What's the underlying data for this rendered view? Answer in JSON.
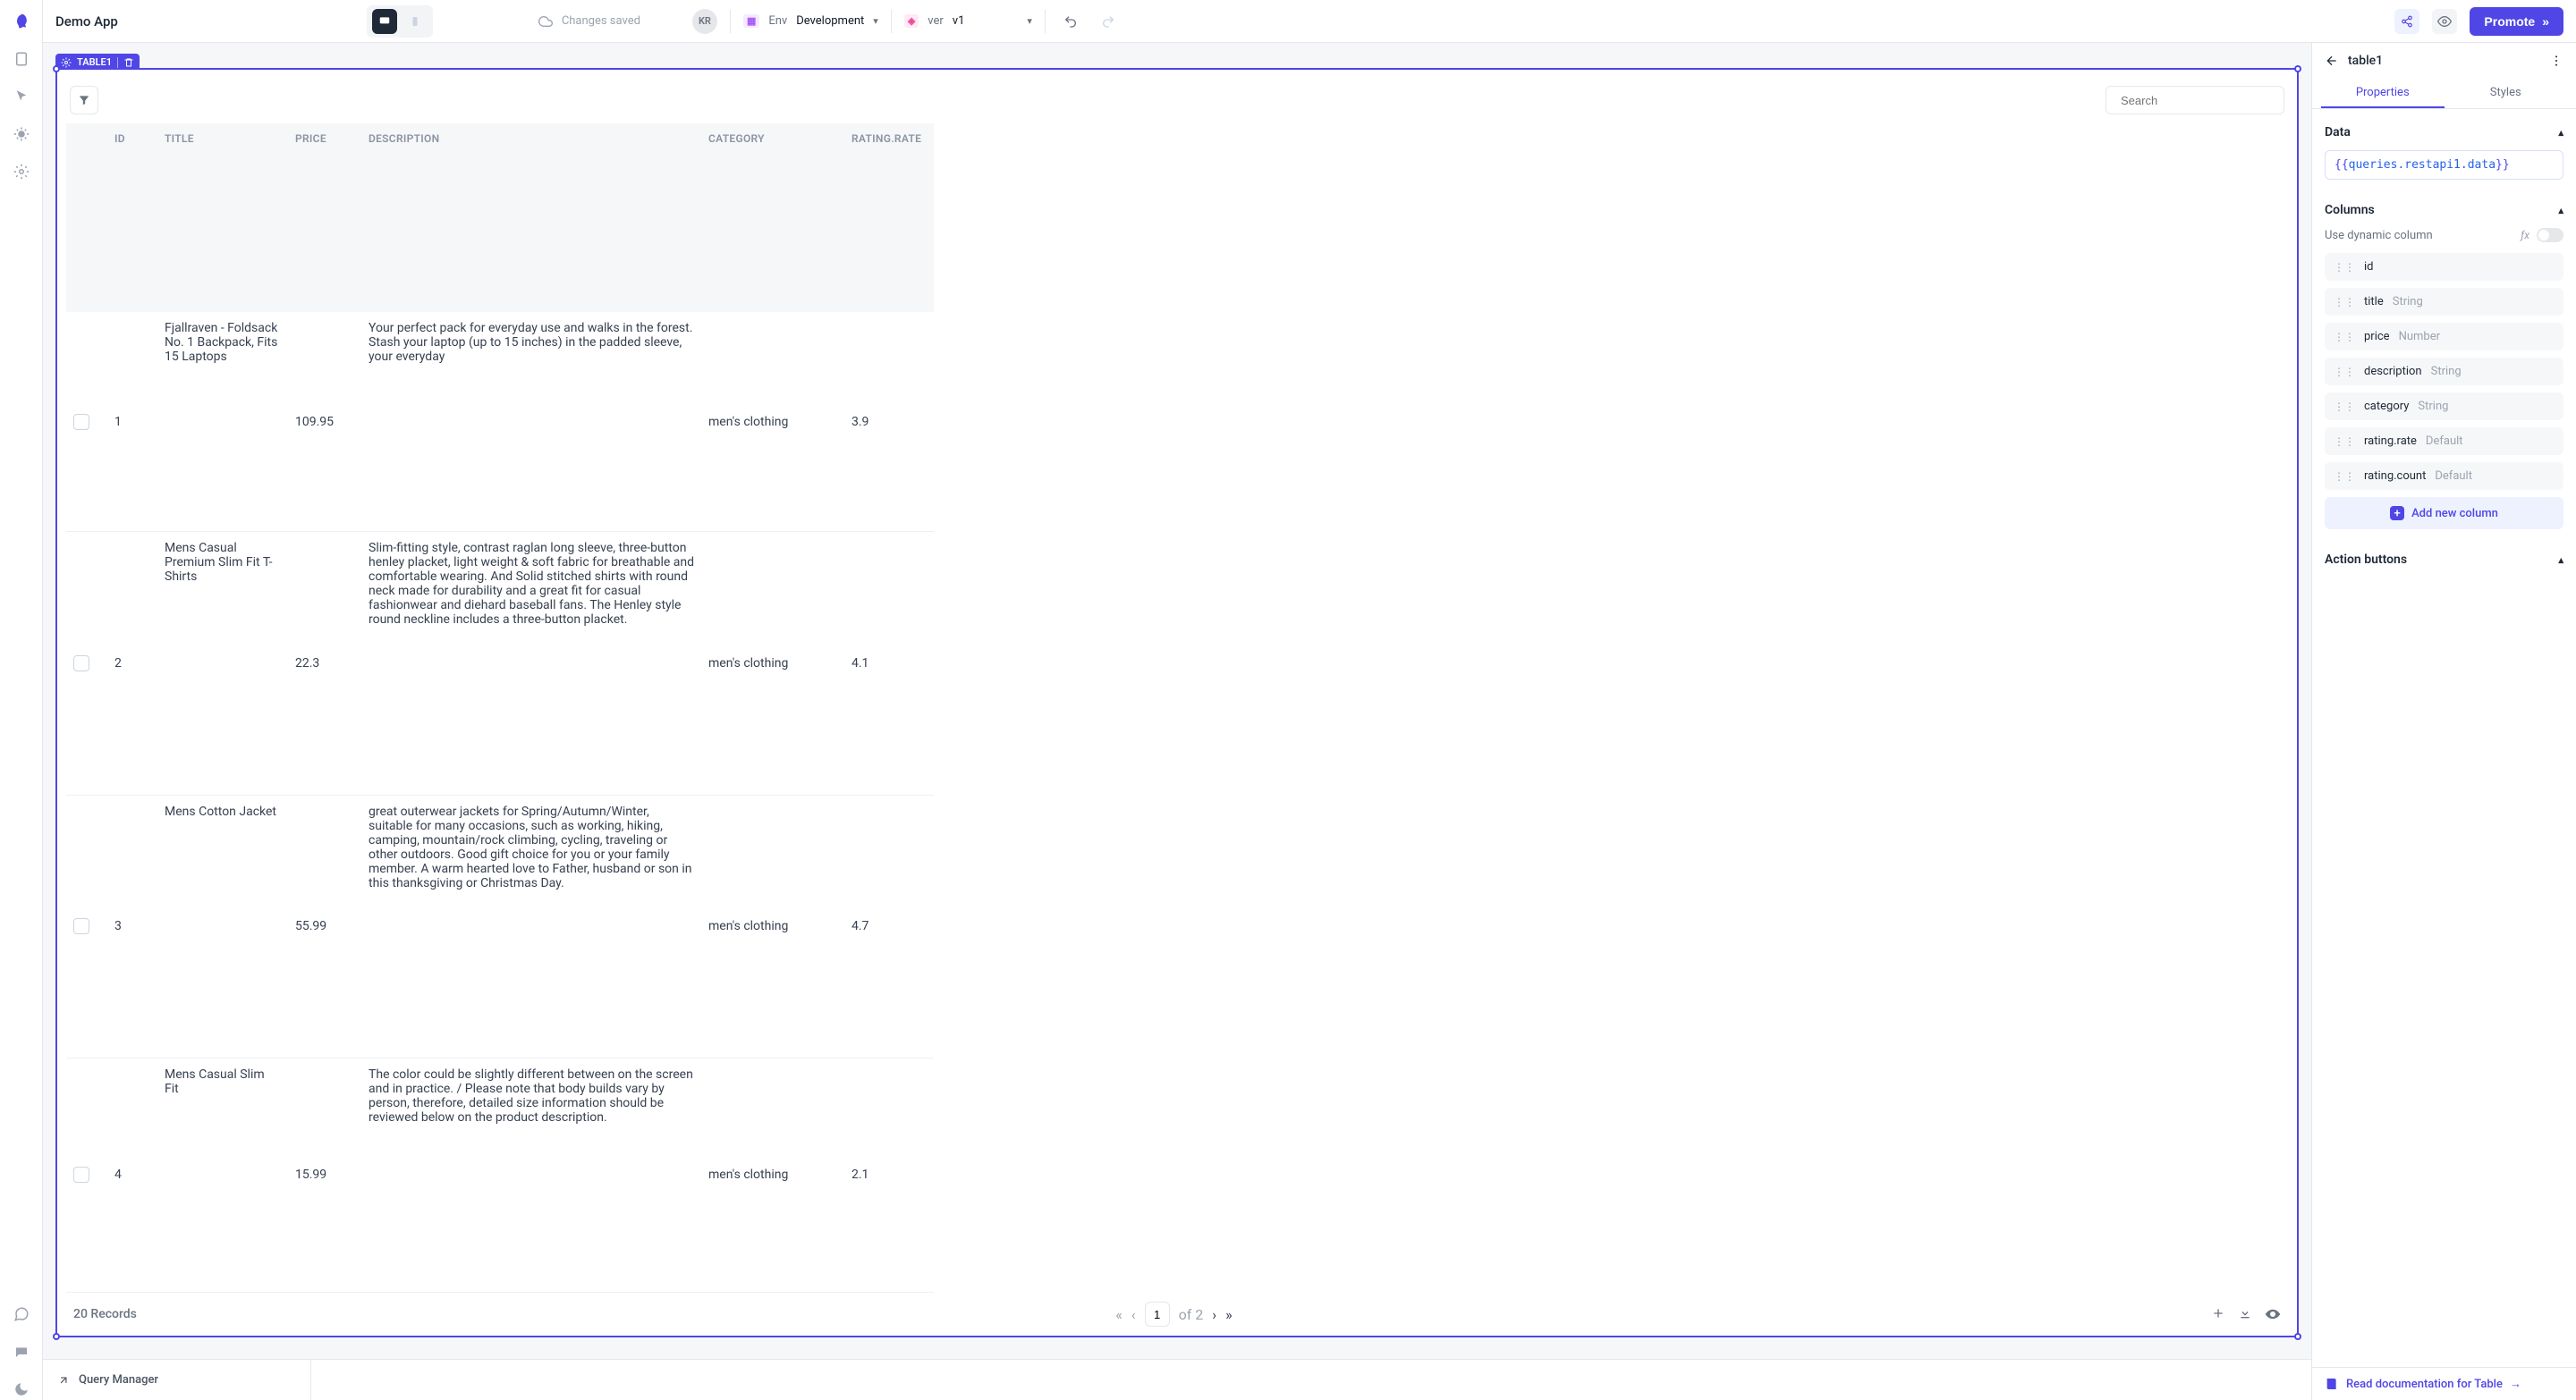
{
  "app": {
    "title": "Demo App"
  },
  "header": {
    "saved_status": "Changes saved",
    "avatar_initials": "KR",
    "env_label": "Env",
    "env_value": "Development",
    "ver_label": "ver",
    "ver_value": "v1",
    "promote_label": "Promote"
  },
  "table_component": {
    "tag": "TABLE1",
    "search_placeholder": "Search",
    "columns": [
      "ID",
      "TITLE",
      "PRICE",
      "DESCRIPTION",
      "CATEGORY",
      "RATING.RATE"
    ],
    "rows": [
      {
        "id": "1",
        "title": "Fjallraven - Foldsack No. 1 Backpack, Fits 15 Laptops",
        "price": "109.95",
        "description": "Your perfect pack for everyday use and walks in the forest. Stash your laptop (up to 15 inches) in the padded sleeve, your everyday",
        "category": "men's clothing",
        "rating": "3.9"
      },
      {
        "id": "2",
        "title": "Mens Casual Premium Slim Fit T-Shirts",
        "price": "22.3",
        "description": "Slim-fitting style, contrast raglan long sleeve, three-button henley placket, light weight & soft fabric for breathable and comfortable wearing. And Solid stitched shirts with round neck made for durability and a great fit for casual fashionwear and diehard baseball fans. The Henley style round neckline includes a three-button placket.",
        "category": "men's clothing",
        "rating": "4.1"
      },
      {
        "id": "3",
        "title": "Mens Cotton Jacket",
        "price": "55.99",
        "description": "great outerwear jackets for Spring/Autumn/Winter, suitable for many occasions, such as working, hiking, camping, mountain/rock climbing, cycling, traveling or other outdoors. Good gift choice for you or your family member. A warm hearted love to Father, husband or son in this thanksgiving or Christmas Day.",
        "category": "men's clothing",
        "rating": "4.7"
      },
      {
        "id": "4",
        "title": "Mens Casual Slim Fit",
        "price": "15.99",
        "description": "The color could be slightly different between on the screen and in practice. / Please note that body builds vary by person, therefore, detailed size information should be reviewed below on the product description.",
        "category": "men's clothing",
        "rating": "2.1"
      }
    ],
    "pager": {
      "records_label": "20 Records",
      "page": "1",
      "of_label": "of 2"
    }
  },
  "right_panel": {
    "title": "table1",
    "tabs": {
      "properties": "Properties",
      "styles": "Styles"
    },
    "sections": {
      "data_title": "Data",
      "data_expr": "queries.restapi1.data",
      "columns_title": "Columns",
      "dynamic_label": "Use dynamic column",
      "columns": [
        {
          "name": "id",
          "type": ""
        },
        {
          "name": "title",
          "type": "String"
        },
        {
          "name": "price",
          "type": "Number"
        },
        {
          "name": "description",
          "type": "String"
        },
        {
          "name": "category",
          "type": "String"
        },
        {
          "name": "rating.rate",
          "type": "Default"
        },
        {
          "name": "rating.count",
          "type": "Default"
        }
      ],
      "add_column_label": "Add new column",
      "action_buttons_title": "Action buttons"
    },
    "doc_link": "Read documentation for Table"
  },
  "query_manager": {
    "label": "Query Manager"
  }
}
